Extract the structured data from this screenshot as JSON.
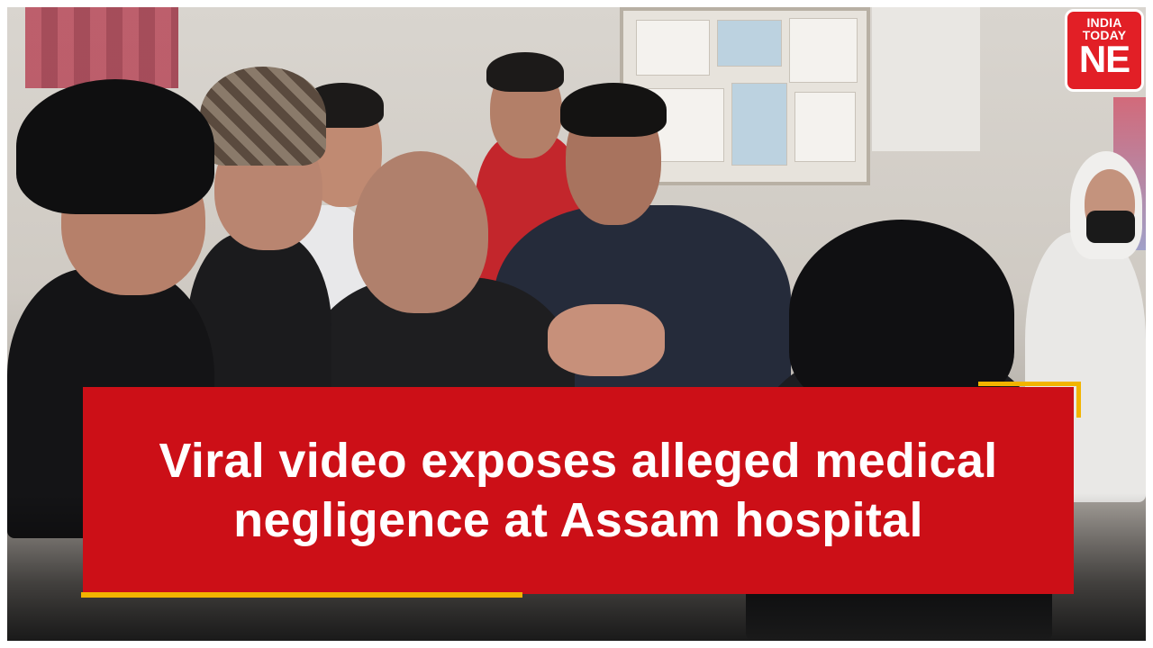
{
  "logo": {
    "line1": "INDIA",
    "line2": "TODAY",
    "line3": "NE",
    "color": "#e21f26"
  },
  "headline": {
    "line1": "Viral video exposes alleged medical",
    "line2": "negligence at Assam hospital",
    "background_color": "#cc0f17",
    "accent_color": "#f2b400"
  }
}
